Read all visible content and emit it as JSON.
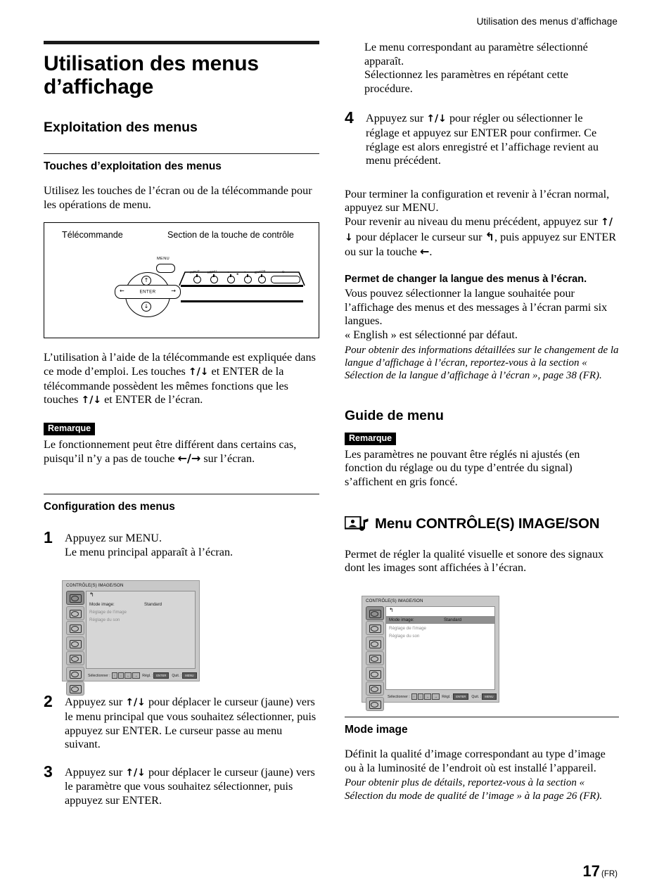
{
  "running_head": "Utilisation des menus d’affichage",
  "page_number": {
    "number": "17",
    "suffix": "(FR)"
  },
  "left_column": {
    "title": "Utilisation des menus d’affichage",
    "section_heading": "Exploitation des menus",
    "sub_heading_1": "Touches d’exploitation des menus",
    "intro_paragraph": "Utilisez les touches de l’écran ou de la télécommande pour les opérations de menu.",
    "illustration": {
      "label_remote": "Télécommande",
      "label_control_section": "Section de la touche de contrôle",
      "remote": {
        "menu_label": "MENU",
        "enter_label": "ENTER",
        "left_arrow": "←",
        "right_arrow": "→",
        "up_arrow": "↑",
        "down_arrow": "↓"
      },
      "control_section": {
        "buttons": [
          "INPUT",
          "MENU",
          "↓",
          "↑",
          "ENTER"
        ],
        "power_label": "POWER"
      }
    },
    "paragraph_after_illustration_a": "L’utilisation à l’aide de la télécommande est expliquée dans ce mode d’emploi. Les touches ",
    "paragraph_after_illustration_b": " et ENTER de la télécommande possèdent les mêmes fonctions que les touches ",
    "paragraph_after_illustration_c": " et ENTER de l’écran.",
    "note_badge": "Remarque",
    "note_text_a": "Le fonctionnement peut être différent dans certains cas, puisqu’il n’y a pas de touche ",
    "note_text_b": " sur l’écran.",
    "sub_heading_2": "Configuration des menus",
    "steps": [
      {
        "number": "1",
        "text": "Appuyez sur MENU.\nLe menu principal apparaît à l’écran."
      },
      {
        "number": "2",
        "text_a": "Appuyez sur ",
        "text_b": " pour déplacer le curseur (jaune) vers le menu principal que vous souhaitez sélectionner, puis appuyez sur ENTER. Le curseur passe au menu suivant."
      },
      {
        "number": "3",
        "text_a": "Appuyez sur ",
        "text_b": " pour déplacer le curseur (jaune) vers le paramètre que vous souhaitez sélectionner, puis appuyez sur ENTER."
      }
    ]
  },
  "osd_screenshot_1": {
    "title": "CONTRÔLE(S) IMAGE/SON",
    "back_arrow": "↰",
    "rows": [
      {
        "label": "Mode image:",
        "value": "Standard",
        "dim": false,
        "highlighted": false
      },
      {
        "label": "Réglage de l’image",
        "value": "",
        "dim": true,
        "highlighted": false
      },
      {
        "label": "Réglage du son",
        "value": "",
        "dim": true,
        "highlighted": false
      }
    ],
    "status": {
      "select_label": "Sélectionner :",
      "adjust_label": "Régl. :",
      "adjust_key": "ENTER",
      "quit_label": "Quit. :",
      "quit_key": "MENU"
    }
  },
  "right_column": {
    "continuation_paragraph": "Le menu correspondant au paramètre sélectionné apparaît.\nSélectionnez les paramètres en répétant cette procédure.",
    "step_4": {
      "number": "4",
      "text_a": "Appuyez sur ",
      "text_b": " pour régler ou sélectionner le réglage et appuyez sur ENTER pour confirmer. Ce réglage est alors enregistré et l’affichage revient au menu précédent."
    },
    "after_steps_a": "Pour terminer la configuration et revenir à l’écran normal, appuyez sur MENU.",
    "after_steps_b": "Pour revenir au niveau du menu précédent, appuyez sur ",
    "after_steps_c": " pour déplacer le curseur sur ",
    "after_steps_d": ", puis appuyez sur ENTER ou sur la touche ",
    "after_steps_e": ".",
    "language_heading": "Permet de changer la langue des menus à l’écran.",
    "language_body": "Vous pouvez sélectionner la langue souhaitée pour l’affichage des menus et des messages à l’écran parmi six langues.\n« English » est sélectionné par défaut.",
    "language_italic": "Pour obtenir des informations détaillées sur le changement de la langue d’affichage à l’écran, reportez-vous à la section « Sélection de la langue d’affichage à l’écran », page 38 (FR).",
    "guide_heading": "Guide de menu",
    "guide_note_badge": "Remarque",
    "guide_note_text": "Les paramètres ne pouvant être réglés ni ajustés (en fonction du réglage ou du type d’entrée du signal) s’affichent en gris foncé.",
    "menu_section_title": "Menu CONTRÔLE(S) IMAGE/SON",
    "menu_section_body": "Permet de régler la qualité visuelle et sonore des signaux dont les images sont affichées à l’écran.",
    "mode_image_heading": "Mode image",
    "mode_image_body": "Définit la qualité d’image correspondant au type d’image ou à la luminosité de l’endroit où est installé l’appareil.",
    "mode_image_italic": "Pour obtenir plus de détails, reportez-vous à la section « Sélection du mode de qualité de l’image » à la page 26 (FR)."
  },
  "osd_screenshot_2": {
    "title": "CONTRÔLE(S) IMAGE/SON",
    "back_arrow": "↰",
    "rows": [
      {
        "label": "Mode image:",
        "value": "Standard",
        "dim": false,
        "highlighted": true
      },
      {
        "label": "Réglage de l’image",
        "value": "",
        "dim": true,
        "highlighted": false
      },
      {
        "label": "Réglage du son",
        "value": "",
        "dim": true,
        "highlighted": false
      }
    ],
    "status": {
      "select_label": "Sélectionner :",
      "adjust_label": "Régl. :",
      "adjust_key": "ENTER",
      "quit_label": "Quit. :",
      "quit_key": "MENU"
    }
  },
  "glyphs": {
    "up_down": "↑/↓",
    "left_right": "←/→",
    "left": "←",
    "return": "↰"
  },
  "colors": {
    "text": "#000000",
    "osd_bg": "#c8c8c8",
    "osd_pane": "#d6d6d6",
    "osd_highlight": "#8f8f8f",
    "osd_dim_text": "#8a8a8a"
  }
}
